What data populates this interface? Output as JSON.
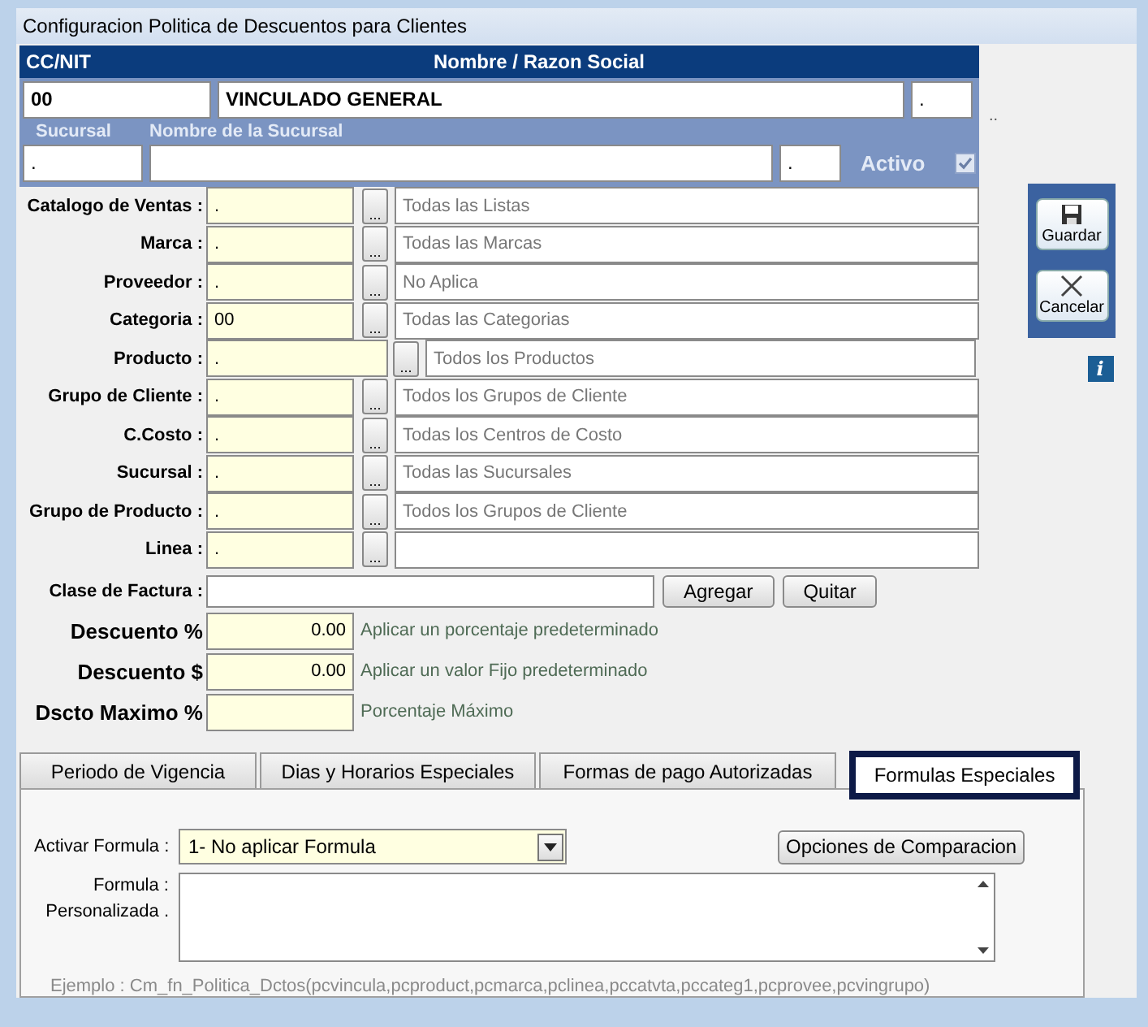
{
  "window": {
    "title": "Configuracion Politica de Descuentos para Clientes"
  },
  "client": {
    "cc_nit_label": "CC/NIT",
    "name_label": "Nombre / Razon Social",
    "cc_nit": "00",
    "name": "VINCULADO GENERAL",
    "code": ".",
    "trailing": "..",
    "branch_label": "Sucursal",
    "branch_name_label": "Nombre de la Sucursal",
    "branch": ".",
    "branch_code": ".",
    "active_label": "Activo",
    "active": true
  },
  "filters": [
    {
      "kind": "standard",
      "label": "Catalogo de Ventas :",
      "code": ".",
      "description": "Todas las Listas"
    },
    {
      "kind": "standard",
      "label": "Marca :",
      "code": ".",
      "description": "Todas las Marcas"
    },
    {
      "kind": "standard",
      "label": "Proveedor :",
      "code": ".",
      "description": "No Aplica"
    },
    {
      "kind": "standard",
      "label": "Categoria :",
      "code": "00",
      "description": "Todas las Categorias"
    },
    {
      "kind": "wide",
      "label": "Producto :",
      "code": ".",
      "description": "Todos los Productos"
    },
    {
      "kind": "standard",
      "label": "Grupo de Cliente :",
      "code": ".",
      "description": "Todos los Grupos de Cliente"
    },
    {
      "kind": "standard",
      "label": "C.Costo :",
      "code": ".",
      "description": "Todas los Centros de Costo"
    },
    {
      "kind": "standard",
      "label": "Sucursal :",
      "code": ".",
      "description": "Todas las Sucursales"
    },
    {
      "kind": "standard",
      "label": "Grupo de Producto :",
      "code": ".",
      "description": "Todos los Grupos de Cliente"
    },
    {
      "kind": "standard",
      "label": "Linea :",
      "code": "."
    }
  ],
  "browse_button": "...",
  "invoice_class": {
    "label": "Clase de Factura :",
    "buttons": [
      "Agregar",
      "Quitar"
    ]
  },
  "discounts": [
    {
      "label": "Descuento %",
      "value": "0.00",
      "hint": "Aplicar un porcentaje predeterminado"
    },
    {
      "label": "Descuento $",
      "value": "0.00",
      "hint": "Aplicar un valor Fijo predeterminado"
    },
    {
      "label": "Dscto Maximo %",
      "hint": "Porcentaje Máximo"
    }
  ],
  "actions": [
    {
      "kind": "save",
      "label": "Guardar"
    },
    {
      "kind": "cancel",
      "label": "Cancelar"
    }
  ],
  "info_button": "i",
  "tabs": [
    {
      "label": "Periodo de  Vigencia",
      "selected": false
    },
    {
      "label": "Dias y Horarios Especiales",
      "selected": false
    },
    {
      "label": "Formas de pago Autorizadas",
      "selected": false
    },
    {
      "label": "Formulas Especiales",
      "selected": true
    }
  ],
  "formula": {
    "label": "Activar Formula :",
    "value": "1-  No aplicar Formula",
    "compare_button": "Opciones de Comparacion",
    "custom_label": [
      "Formula :",
      "Personalizada ."
    ],
    "example": "Ejemplo :  Cm_fn_Politica_Dctos(pcvincula,pcproduct,pcmarca,pclinea,pccatvta,pccateg1,pcprovee,pcvingrupo)"
  }
}
